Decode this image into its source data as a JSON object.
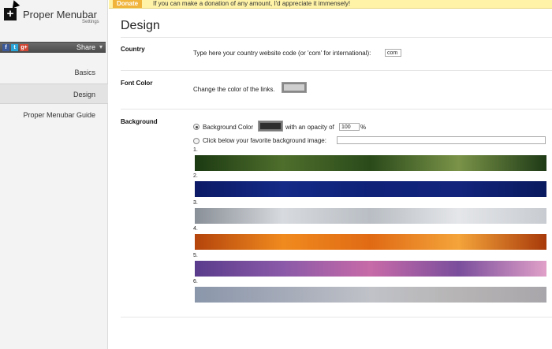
{
  "sidebar": {
    "app_title": "Proper Menubar",
    "app_subtitle": "Settings",
    "share_label": "Share",
    "share_icons": [
      "facebook-icon",
      "twitter-icon",
      "google-plus-icon"
    ],
    "nav": [
      {
        "label": "Basics",
        "active": false
      },
      {
        "label": "Design",
        "active": true
      },
      {
        "label": "Proper Menubar Guide",
        "active": false
      }
    ]
  },
  "banner": {
    "donate_label": "Donate",
    "message": "If you can make a donation of any amount, I'd appreciate it immensely!"
  },
  "main": {
    "title": "Design",
    "country": {
      "label": "Country",
      "description": "Type here your country website code (or 'com' for international):",
      "value": "com"
    },
    "font_color": {
      "label": "Font Color",
      "description": "Change the color of the links.",
      "color": "#cfcfcf"
    },
    "background": {
      "label": "Background",
      "color_option_label": "Background Color",
      "color": "#2e2e2e",
      "opacity_label": "with an opacity of",
      "opacity_value": "100",
      "opacity_unit": "%",
      "image_option_label": "Click below your favorite background image:",
      "image_input_value": "",
      "images": [
        {
          "num": "1.",
          "colors": [
            "#1c3a12",
            "#4e6e2c",
            "#2a4a1a",
            "#7a9348",
            "#1e3a16"
          ]
        },
        {
          "num": "2.",
          "colors": [
            "#0c1a66",
            "#142a86",
            "#0f2278",
            "#12247c",
            "#0a1a5e"
          ]
        },
        {
          "num": "3.",
          "colors": [
            "#8a9098",
            "#d7dade",
            "#b9bec4",
            "#e4e6e9",
            "#c8ccd1"
          ]
        },
        {
          "num": "4.",
          "colors": [
            "#b4440c",
            "#f08a1e",
            "#e06a14",
            "#f4a43a",
            "#a83a0a"
          ]
        },
        {
          "num": "5.",
          "colors": [
            "#5a3c8c",
            "#8a5aa8",
            "#c76aa8",
            "#7a4e9c",
            "#e0a0c8"
          ]
        },
        {
          "num": "6.",
          "colors": [
            "#8a96aa",
            "#a4aab8",
            "#c0c2c8",
            "#b6b4b4",
            "#a8a6aa"
          ]
        }
      ]
    }
  }
}
